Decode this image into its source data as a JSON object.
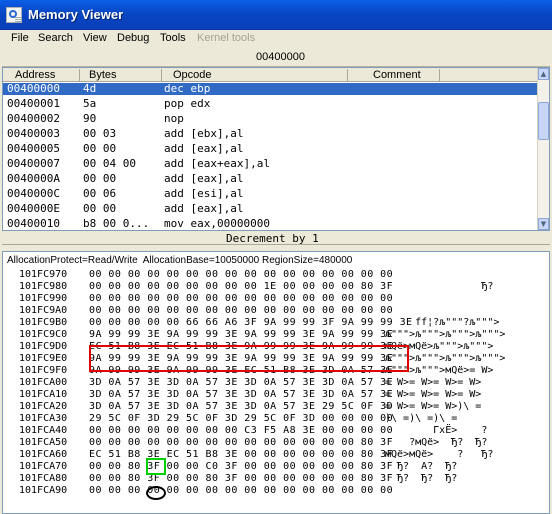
{
  "window": {
    "title": "Memory Viewer",
    "icon": "memory-viewer-icon"
  },
  "menu": {
    "items": [
      {
        "label": "File",
        "enabled": true
      },
      {
        "label": "Search",
        "enabled": true
      },
      {
        "label": "View",
        "enabled": true
      },
      {
        "label": "Debug",
        "enabled": true
      },
      {
        "label": "Tools",
        "enabled": true
      },
      {
        "label": "Kernel tools",
        "enabled": false
      }
    ]
  },
  "disassembler": {
    "current_address": "00400000",
    "columns": {
      "address": "Address",
      "bytes": "Bytes",
      "opcode": "Opcode",
      "comment": "Comment"
    },
    "rows": [
      {
        "address": "00400000",
        "bytes": "4d",
        "opcode": "dec ebp",
        "selected": true
      },
      {
        "address": "00400001",
        "bytes": "5a",
        "opcode": "pop edx"
      },
      {
        "address": "00400002",
        "bytes": "90",
        "opcode": "nop"
      },
      {
        "address": "00400003",
        "bytes": "00 03",
        "opcode": "add [ebx],al"
      },
      {
        "address": "00400005",
        "bytes": "00 00",
        "opcode": "add [eax],al"
      },
      {
        "address": "00400007",
        "bytes": "00 04 00",
        "opcode": "add [eax+eax],al"
      },
      {
        "address": "0040000A",
        "bytes": "00 00",
        "opcode": "add [eax],al"
      },
      {
        "address": "0040000C",
        "bytes": "00 06",
        "opcode": "add [esi],al"
      },
      {
        "address": "0040000E",
        "bytes": "00 00",
        "opcode": "add [eax],al"
      },
      {
        "address": "00400010",
        "bytes": "b8 00 0...",
        "opcode": "mov eax,00000000"
      }
    ]
  },
  "instruction_status": "Decrement by 1",
  "hexview": {
    "alloc_info": "AllocationProtect=Read/Write  AllocationBase=10050000 RegionSize=480000",
    "rows": [
      {
        "address": "101FC970",
        "bytes": "00 00 00 00 00 00 00 00 00 00 00 00 00 00 00 00",
        "ascii": ""
      },
      {
        "address": "101FC980",
        "bytes": "00 00 00 00 00 00 00 00 00 1E 00 00 00 00 80 3F",
        "ascii": "                Ђ?"
      },
      {
        "address": "101FC990",
        "bytes": "00 00 00 00 00 00 00 00 00 00 00 00 00 00 00 00",
        "ascii": ""
      },
      {
        "address": "101FC9A0",
        "bytes": "00 00 00 00 00 00 00 00 00 00 00 00 00 00 00 00",
        "ascii": ""
      },
      {
        "address": "101FC9B0",
        "bytes": "00 00 00 00 00 66 66 A6 3F 9A 99 99 3F 9A 99 99 3E",
        "ascii": "     ff¦?љ\"\"\"?љ\"\"\">"
      },
      {
        "address": "101FC9C0",
        "bytes": "9A 99 99 3E 9A 99 99 3E 9A 99 99 3E 9A 99 99 3E",
        "ascii": "љ\"\"\">љ\"\"\">љ\"\"\">љ\"\"\">"
      },
      {
        "address": "101FC9D0",
        "bytes": "EC 51 B8 3E EC 51 B8 3E 9A 99 99 3E 9A 99 99 3E",
        "ascii": "мQё>мQё>љ\"\"\">љ\"\"\">"
      },
      {
        "address": "101FC9E0",
        "bytes": "9A 99 99 3E 9A 99 99 3E 9A 99 99 3E 9A 99 99 3E",
        "ascii": "љ\"\"\">љ\"\"\">љ\"\"\">љ\"\"\">"
      },
      {
        "address": "101FC9F0",
        "bytes": "9A 99 99 3E 9A 99 99 3E EC 51 B8 3E 3D 0A 57 3E",
        "ascii": "љ\"\"\">љ\"\"\">мQё>= W>"
      },
      {
        "address": "101FCA00",
        "bytes": "3D 0A 57 3E 3D 0A 57 3E 3D 0A 57 3E 3D 0A 57 3E",
        "ascii": "= W>= W>= W>= W>"
      },
      {
        "address": "101FCA10",
        "bytes": "3D 0A 57 3E 3D 0A 57 3E 3D 0A 57 3E 3D 0A 57 3E",
        "ascii": "= W>= W>= W>= W>"
      },
      {
        "address": "101FCA20",
        "bytes": "3D 0A 57 3E 3D 0A 57 3E 3D 0A 57 3E 29 5C 0F 3D",
        "ascii": "= W>= W>= W>)\\ ="
      },
      {
        "address": "101FCA30",
        "bytes": "29 5C 0F 3D 29 5C 0F 3D 29 5C 0F 3D 00 00 00 00",
        "ascii": ")\\ =)\\ =)\\ ="
      },
      {
        "address": "101FCA40",
        "bytes": "00 00 00 00 00 00 00 00 C3 F5 A8 3E 00 00 00 00",
        "ascii": "        ГхЁ>    ?"
      },
      {
        "address": "101FCA50",
        "bytes": "00 00 00 00 00 00 00 00 00 00 00 00 00 00 80 3F",
        "ascii": "    ?мQё>  Ђ?  Ђ?"
      },
      {
        "address": "101FCA60",
        "bytes": "EC 51 B8 3E EC 51 B8 3E 00 00 00 00 00 00 80 3F",
        "ascii": "мQё>мQё>    ?   Ђ?"
      },
      {
        "address": "101FCA70",
        "bytes": "00 00 80 3F 00 00 C0 3F 00 00 00 00 00 00 80 3F",
        "ascii": "  Ђ?  А?  Ђ?"
      },
      {
        "address": "101FCA80",
        "bytes": "00 00 80 3F 00 00 80 3F 00 00 00 00 00 00 80 3F",
        "ascii": "  Ђ?  Ђ?  Ђ?"
      },
      {
        "address": "101FCA90",
        "bytes": "00 00 00 00 00 00 00 00 00 00 00 00 00 00 00 00",
        "ascii": ""
      }
    ]
  },
  "colors": {
    "titlebar": "#0a5fe8",
    "selection": "#316ac5",
    "highlight_red": "#e00000",
    "highlight_green": "#00d000",
    "highlight_black": "#000000"
  }
}
